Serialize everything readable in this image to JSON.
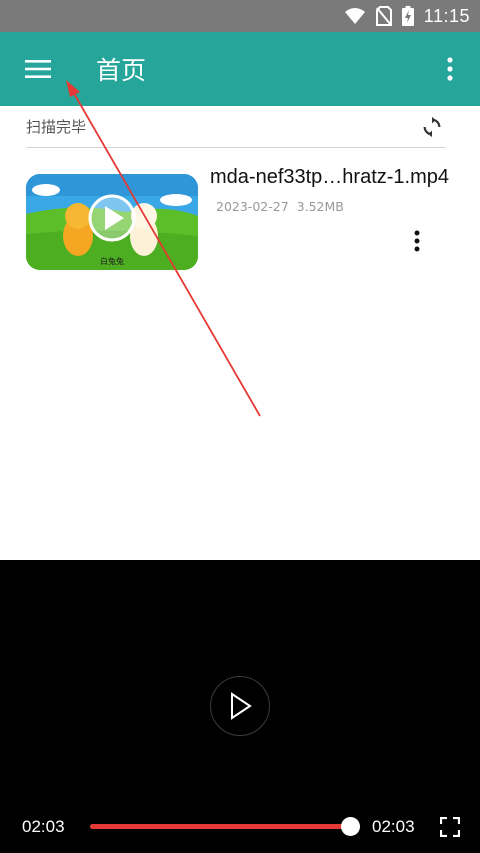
{
  "status_bar": {
    "time": "11:15"
  },
  "app_bar": {
    "title": "首页"
  },
  "scan": {
    "status": "扫描完毕"
  },
  "video_list": [
    {
      "file_name": "mda-nef33tp…hratz-1.mp4",
      "date": "2023-02-27",
      "size": "3.52MB",
      "thumb_label": "白兔兔"
    }
  ],
  "player": {
    "current_time": "02:03",
    "total_time": "02:03",
    "progress_fraction": 1.0
  },
  "colors": {
    "app_bar": "#26a69a",
    "progress": "#e53935",
    "annotation_arrow": "#e53935"
  },
  "icons": {
    "menu": "menu-icon",
    "more": "more-vert-icon",
    "refresh": "refresh-icon",
    "play": "play-icon",
    "fullscreen": "fullscreen-icon"
  }
}
